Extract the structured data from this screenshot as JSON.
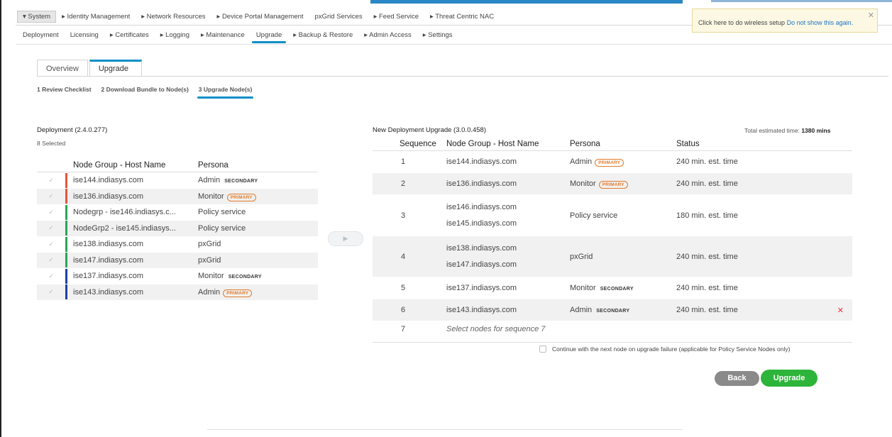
{
  "topnav": [
    {
      "label": "▾ System",
      "active": true
    },
    {
      "label": "▸ Identity Management"
    },
    {
      "label": "▸ Network Resources"
    },
    {
      "label": "▸ Device Portal Management"
    },
    {
      "label": "pxGrid Services"
    },
    {
      "label": "▸ Feed Service"
    },
    {
      "label": "▸ Threat Centric NAC"
    }
  ],
  "subnav": [
    {
      "label": "Deployment"
    },
    {
      "label": "Licensing"
    },
    {
      "label": "▸ Certificates"
    },
    {
      "label": "▸ Logging"
    },
    {
      "label": "▸ Maintenance"
    },
    {
      "label": "Upgrade",
      "active": true
    },
    {
      "label": "▸ Backup & Restore"
    },
    {
      "label": "▸ Admin Access"
    },
    {
      "label": "▸ Settings"
    }
  ],
  "wireless": {
    "text": "Click here to do wireless setup",
    "link": "Do not show this again.",
    "close": "✕"
  },
  "tabs": [
    {
      "label": "Overview"
    },
    {
      "label": "Upgrade",
      "active": true
    }
  ],
  "steps": [
    {
      "label": "1 Review Checklist"
    },
    {
      "label": "2 Download Bundle to Node(s)"
    },
    {
      "label": "3 Upgrade Node(s)",
      "active": true
    }
  ],
  "deployment": {
    "title": "Deployment (2.4.0.277)",
    "selected": "8 Selected",
    "headers": {
      "host": "Node Group - Host Name",
      "persona": "Persona"
    },
    "rows": [
      {
        "host": "ise144.indiasys.com",
        "persona": "Admin",
        "badge": "SECONDARY",
        "bar": "#e8533c"
      },
      {
        "host": "ise136.indiasys.com",
        "persona": "Monitor",
        "badge": "PRIMARY",
        "bar": "#e8533c"
      },
      {
        "host": "Nodegrp - ise146.indiasys.c...",
        "persona": "Policy service",
        "badge": "",
        "bar": "#2aa55a"
      },
      {
        "host": "NodeGrp2 - ise145.indiasys...",
        "persona": "Policy service",
        "badge": "",
        "bar": "#2aa55a"
      },
      {
        "host": "ise138.indiasys.com",
        "persona": "pxGrid",
        "badge": "",
        "bar": "#2aa55a"
      },
      {
        "host": "ise147.indiasys.com",
        "persona": "pxGrid",
        "badge": "",
        "bar": "#2aa55a"
      },
      {
        "host": "ise137.indiasys.com",
        "persona": "Monitor",
        "badge": "SECONDARY",
        "bar": "#1d3fa8"
      },
      {
        "host": "ise143.indiasys.com",
        "persona": "Admin",
        "badge": "PRIMARY",
        "bar": "#1d3fa8"
      }
    ],
    "check_glyph": "✓"
  },
  "move_button": "▶",
  "new_deployment": {
    "title": "New Deployment Upgrade (3.0.0.458)",
    "total_label": "Total estimated time:",
    "total_value": "1380 mins",
    "headers": {
      "sequence": "Sequence",
      "host": "Node Group - Host Name",
      "persona": "Persona",
      "status": "Status"
    },
    "rows": [
      {
        "seq": "1",
        "hosts": [
          "ise144.indiasys.com"
        ],
        "persona": "Admin",
        "badge": "PRIMARY",
        "status": "240 min. est. time"
      },
      {
        "seq": "2",
        "hosts": [
          "ise136.indiasys.com"
        ],
        "persona": "Monitor",
        "badge": "PRIMARY",
        "status": "240 min. est. time"
      },
      {
        "seq": "3",
        "hosts": [
          "ise146.indiasys.com",
          "ise145.indiasys.com"
        ],
        "persona": "Policy service",
        "badge": "",
        "status": "180 min. est. time"
      },
      {
        "seq": "4",
        "hosts": [
          "ise138.indiasys.com",
          "ise147.indiasys.com"
        ],
        "persona": "pxGrid",
        "badge": "",
        "status": "240 min. est. time"
      },
      {
        "seq": "5",
        "hosts": [
          "ise137.indiasys.com"
        ],
        "persona": "Monitor",
        "badge": "SECONDARY",
        "status": "240 min. est. time"
      },
      {
        "seq": "6",
        "hosts": [
          "ise143.indiasys.com"
        ],
        "persona": "Admin",
        "badge": "SECONDARY",
        "status": "240 min. est. time",
        "removable": true
      }
    ],
    "placeholder_seq": "7",
    "placeholder_text": "Select nodes for sequence 7",
    "remove_glyph": "✕"
  },
  "continue_label": "Continue with the next node on upgrade failure (applicable for Policy Service Nodes only)",
  "buttons": {
    "back": "Back",
    "upgrade": "Upgrade"
  }
}
